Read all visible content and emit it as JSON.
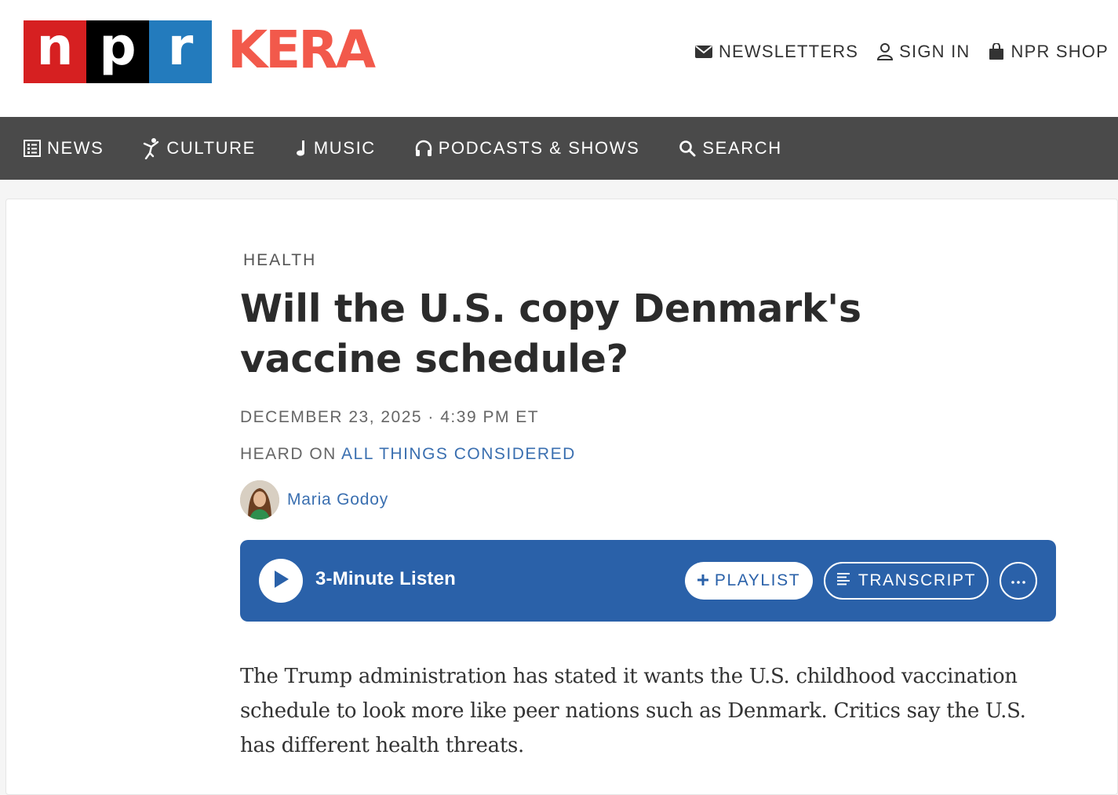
{
  "brand": {
    "npr_letters": [
      "n",
      "p",
      "r"
    ],
    "station_name": "KERA",
    "colors": {
      "npr_red": "#d62021",
      "npr_black": "#000000",
      "npr_blue": "#237bbd",
      "station_coral": "#f2594b",
      "nav_bg": "#4a4a4a",
      "player_blue": "#2a61a9",
      "link_blue": "#3a6fb0"
    }
  },
  "utility_nav": {
    "newsletters": {
      "label": "NEWSLETTERS",
      "icon": "envelope-icon"
    },
    "sign_in": {
      "label": "SIGN IN",
      "icon": "user-icon"
    },
    "shop": {
      "label": "NPR SHOP",
      "icon": "shopping-bag-icon"
    }
  },
  "main_nav": {
    "news": {
      "label": "NEWS",
      "icon": "newspaper-icon"
    },
    "culture": {
      "label": "CULTURE",
      "icon": "dancer-icon"
    },
    "music": {
      "label": "MUSIC",
      "icon": "music-note-icon"
    },
    "podcasts": {
      "label": "PODCASTS & SHOWS",
      "icon": "headphones-icon"
    },
    "search": {
      "label": "SEARCH",
      "icon": "search-icon"
    }
  },
  "article": {
    "section": "HEALTH",
    "headline": "Will the U.S. copy Denmark's vaccine schedule?",
    "dateline": "DECEMBER 23, 2025 · 4:39 PM ET",
    "heard_on_prefix": "HEARD ON ",
    "program": "ALL THINGS CONSIDERED",
    "author": "Maria Godoy",
    "teaser": "The Trump administration has stated it wants the U.S. childhood vaccination schedule to look more like peer nations such as Denmark. Critics say the U.S. has different health threats."
  },
  "player": {
    "listen_label": "3-Minute Listen",
    "playlist_label": "PLAYLIST",
    "transcript_label": "TRANSCRIPT",
    "play_icon": "play-icon",
    "more_icon": "ellipsis-icon"
  }
}
